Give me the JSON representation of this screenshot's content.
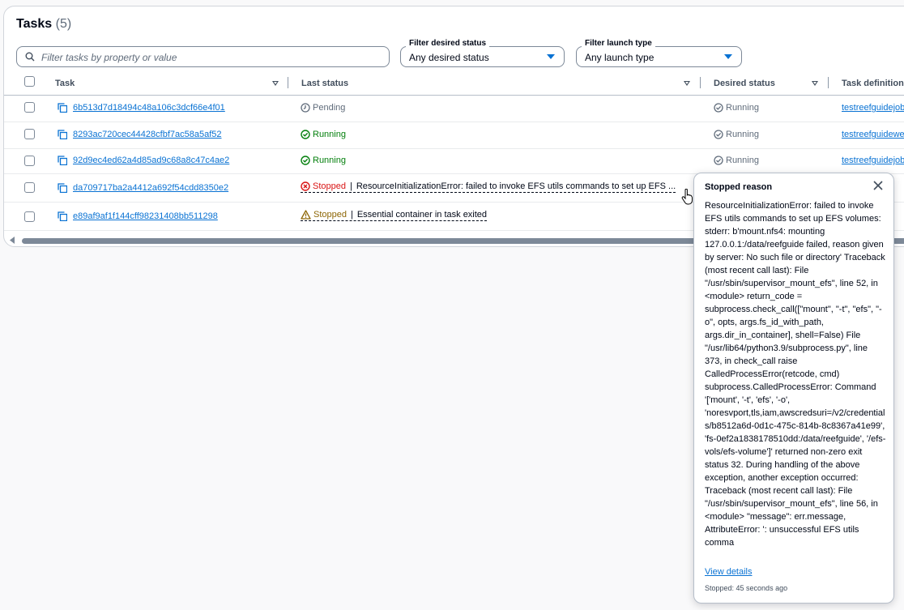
{
  "title": "Tasks",
  "count": "(5)",
  "search": {
    "placeholder": "Filter tasks by property or value"
  },
  "filters": [
    {
      "label": "Filter desired status",
      "value": "Any desired status"
    },
    {
      "label": "Filter launch type",
      "value": "Any launch type"
    }
  ],
  "columns": {
    "task": "Task",
    "last_status": "Last status",
    "desired_status": "Desired status",
    "task_definition": "Task definition"
  },
  "rows": [
    {
      "task_id": "6b513d7d18494c48a106c3dcf66e4f01",
      "last_status": "Pending",
      "desired_status": "Running",
      "task_def": "testreefguidejob"
    },
    {
      "task_id": "8293ac720cec44428cfbf7ac58a5af52",
      "last_status": "Running",
      "desired_status": "Running",
      "task_def": "testreefguidewe"
    },
    {
      "task_id": "92d9ec4ed62a4d85ad9c68a8c47c4ae2",
      "last_status": "Running",
      "desired_status": "Running",
      "task_def": "testreefguidejob"
    },
    {
      "task_id": "da709717ba2a4412a692f54cdd8350e2",
      "last_status": "Stopped",
      "reason": "ResourceInitializationError: failed to invoke EFS utils commands to set up EFS ...",
      "desired_status": "",
      "task_def": ""
    },
    {
      "task_id": "e89af9af1f144cff98231408bb511298",
      "last_status": "Stopped",
      "reason": "Essential container in task exited",
      "desired_status": "",
      "task_def": ""
    }
  ],
  "popover": {
    "title": "Stopped reason",
    "body": "ResourceInitializationError: failed to invoke EFS utils commands to set up EFS volumes: stderr: b'mount.nfs4: mounting 127.0.0.1:/data/reefguide failed, reason given by server: No such file or directory' Traceback (most recent call last): File \"/usr/sbin/supervisor_mount_efs\", line 52, in <module> return_code = subprocess.check_call([\"mount\", \"-t\", \"efs\", \"-o\", opts, args.fs_id_with_path, args.dir_in_container], shell=False) File \"/usr/lib64/python3.9/subprocess.py\", line 373, in check_call raise CalledProcessError(retcode, cmd) subprocess.CalledProcessError: Command '['mount', '-t', 'efs', '-o', 'noresvport,tls,iam,awscredsuri=/v2/credentials/b8512a6d-0d1c-475c-814b-8c8367a41e99', 'fs-0ef2a1838178510dd:/data/reefguide', '/efs-vols/efs-volume']' returned non-zero exit status 32. During handling of the above exception, another exception occurred: Traceback (most recent call last): File \"/usr/sbin/supervisor_mount_efs\", line 56, in <module> \"message\": err.message, AttributeError: ': unsuccessful EFS utils comma",
    "link": "View details",
    "footer": "Stopped: 45 seconds ago"
  },
  "colors": {
    "link": "#0972d3",
    "success": "#037f0c",
    "error": "#d91515",
    "warning": "#8d6605"
  },
  "icons": [
    "search-icon",
    "copy-icon",
    "clock-icon",
    "check-circle-icon",
    "x-circle-icon",
    "warning-icon",
    "close-icon",
    "caret-down-icon",
    "pointer-cursor-icon"
  ]
}
